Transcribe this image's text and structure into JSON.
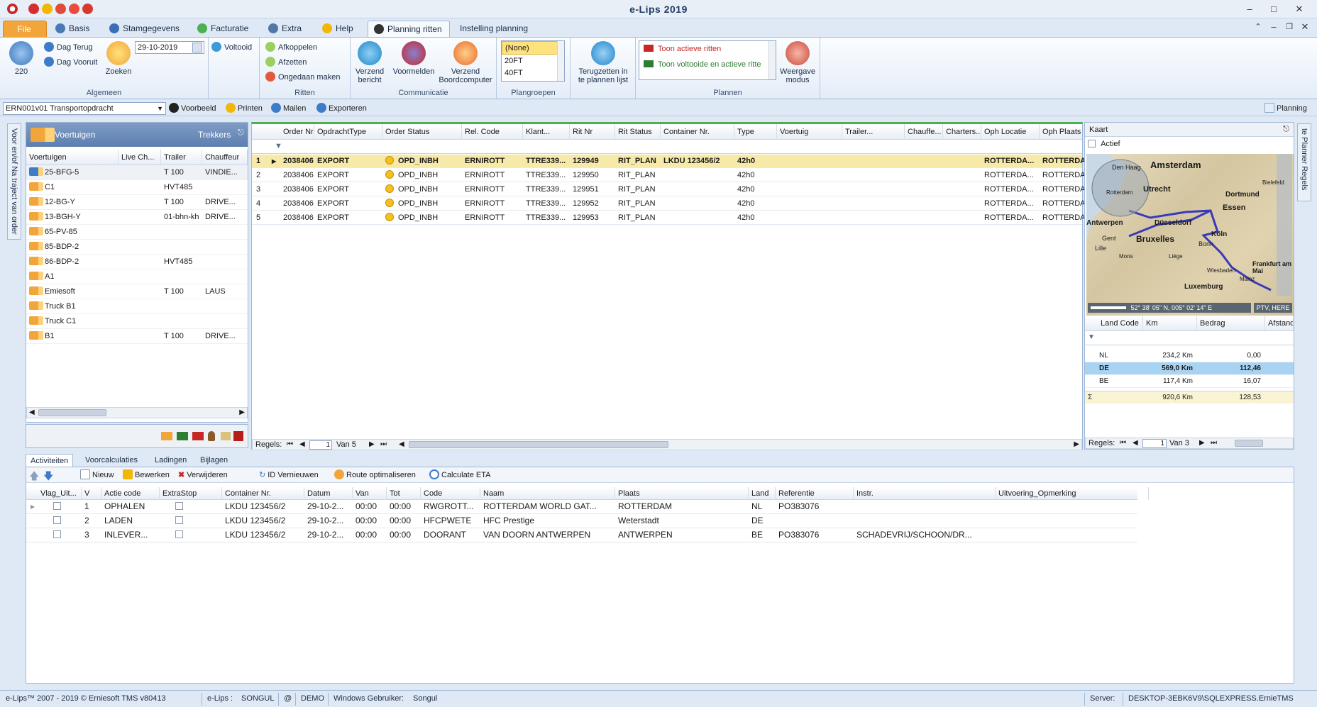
{
  "window": {
    "title": "e-Lips 2019"
  },
  "tabs": [
    {
      "label": "File"
    },
    {
      "label": "Basis"
    },
    {
      "label": "Stamgegevens"
    },
    {
      "label": "Facturatie"
    },
    {
      "label": "Extra"
    },
    {
      "label": "Help"
    },
    {
      "label": "Planning ritten"
    },
    {
      "label": "Instelling planning"
    }
  ],
  "ribbon": {
    "algemeen": {
      "label": "Algemeen",
      "refresh_count": "220",
      "dag_terug": "Dag Terug",
      "dag_vooruit": "Dag Vooruit",
      "zoeken": "Zoeken",
      "date": "29-10-2019",
      "voltooid": "Voltooid"
    },
    "ritten": {
      "label": "Ritten",
      "afkoppelen": "Afkoppelen",
      "afzetten": "Afzetten",
      "ongedaan": "Ongedaan maken"
    },
    "communicatie": {
      "label": "Communicatie",
      "verzend_bericht_1": "Verzend",
      "verzend_bericht_2": "bericht",
      "voormelden": "Voormelden",
      "boordcomputer_1": "Verzend",
      "boordcomputer_2": "Boordcomputer"
    },
    "plangroepen": {
      "label": "Plangroepen",
      "items": [
        "(None)",
        "20FT",
        "40FT"
      ]
    },
    "terug": {
      "line1": "Terugzetten in",
      "line2": "te plannen lijst"
    },
    "plannen": {
      "label": "Plannen",
      "toon_actieve": "Toon actieve ritten",
      "toon_voltooide": "Toon voltooide en actieve ritte",
      "weergave_1": "Weergave",
      "weergave_2": "modus"
    }
  },
  "toolbar2": {
    "report": "ERN001v01 Transportopdracht",
    "voorbeeld": "Voorbeeld",
    "printen": "Printen",
    "mailen": "Mailen",
    "exporteren": "Exporteren",
    "planning": "Planning"
  },
  "left_side_label": "Voor en/of Na traject van order",
  "right_side_label": "te Planner Regels",
  "vehicles": {
    "title": "Voertuigen",
    "trekkers": "Trekkers",
    "columns": [
      "Voertuigen",
      "Live Ch...",
      "Trailer",
      "Chauffeur"
    ],
    "rows": [
      {
        "name": "25-BFG-5",
        "live": "",
        "trailer": "T 100",
        "driver": "VINDIE..."
      },
      {
        "name": "C1",
        "live": "",
        "trailer": "HVT485",
        "driver": ""
      },
      {
        "name": "12-BG-Y",
        "live": "",
        "trailer": "T 100",
        "driver": "DRIVE..."
      },
      {
        "name": "13-BGH-Y",
        "live": "",
        "trailer": "01-bhn-kh",
        "driver": "DRIVE..."
      },
      {
        "name": "65-PV-85",
        "live": "",
        "trailer": "",
        "driver": ""
      },
      {
        "name": "85-BDP-2",
        "live": "",
        "trailer": "",
        "driver": ""
      },
      {
        "name": "86-BDP-2",
        "live": "",
        "trailer": "HVT485",
        "driver": ""
      },
      {
        "name": "A1",
        "live": "",
        "trailer": "",
        "driver": ""
      },
      {
        "name": "Emiesoft",
        "live": "",
        "trailer": "T 100",
        "driver": "LAUS"
      },
      {
        "name": "Truck B1",
        "live": "",
        "trailer": "",
        "driver": ""
      },
      {
        "name": "Truck C1",
        "live": "",
        "trailer": "",
        "driver": ""
      },
      {
        "name": "B1",
        "live": "",
        "trailer": "T 100",
        "driver": "DRIVE..."
      }
    ]
  },
  "orders": {
    "columns": [
      "Order Nr",
      "OpdrachtType",
      "Order Status",
      "Rel. Code",
      "Klant...",
      "Rit Nr",
      "Rit Status",
      "Container Nr.",
      "Type",
      "Voertuig",
      "Trailer...",
      "Chauffe...",
      "Charters...",
      "Oph Locatie",
      "Oph Plaats"
    ],
    "rows": [
      {
        "idx": "1",
        "order": "2038406",
        "type": "EXPORT",
        "status": "OPD_INBH",
        "rel": "ERNIROTT",
        "klant": "TTRE339...",
        "rit": "129949",
        "ritstatus": "RIT_PLAN",
        "container": "LKDU 123456/2",
        "ctype": "42h0",
        "loc": "ROTTERDA...",
        "plaats": "ROTTERDAM"
      },
      {
        "idx": "2",
        "order": "2038406",
        "type": "EXPORT",
        "status": "OPD_INBH",
        "rel": "ERNIROTT",
        "klant": "TTRE339...",
        "rit": "129950",
        "ritstatus": "RIT_PLAN",
        "container": "",
        "ctype": "42h0",
        "loc": "ROTTERDA...",
        "plaats": "ROTTERDAM"
      },
      {
        "idx": "3",
        "order": "2038406",
        "type": "EXPORT",
        "status": "OPD_INBH",
        "rel": "ERNIROTT",
        "klant": "TTRE339...",
        "rit": "129951",
        "ritstatus": "RIT_PLAN",
        "container": "",
        "ctype": "42h0",
        "loc": "ROTTERDA...",
        "plaats": "ROTTERDAM"
      },
      {
        "idx": "4",
        "order": "2038406",
        "type": "EXPORT",
        "status": "OPD_INBH",
        "rel": "ERNIROTT",
        "klant": "TTRE339...",
        "rit": "129952",
        "ritstatus": "RIT_PLAN",
        "container": "",
        "ctype": "42h0",
        "loc": "ROTTERDA...",
        "plaats": "ROTTERDAM"
      },
      {
        "idx": "5",
        "order": "2038406",
        "type": "EXPORT",
        "status": "OPD_INBH",
        "rel": "ERNIROTT",
        "klant": "TTRE339...",
        "rit": "129953",
        "ritstatus": "RIT_PLAN",
        "container": "",
        "ctype": "42h0",
        "loc": "ROTTERDA...",
        "plaats": "ROTTERDAM"
      }
    ],
    "footer": {
      "regels": "Regels:",
      "page": "1",
      "van": "Van 5"
    }
  },
  "map": {
    "title": "Kaart",
    "actief": "Actief",
    "cities": [
      "Den Haag",
      "Amsterdam",
      "Utrecht",
      "Rotterdam",
      "Bielefeld",
      "Dortmund",
      "Essen",
      "Antwerpen",
      "Düsseldorf",
      "Köln",
      "Gent",
      "Bruxelles",
      "Bonn",
      "Lille",
      "Mons",
      "Liège",
      "Wiesbaden",
      "Frankfurt am Mai",
      "Luxemburg",
      "Mainz"
    ],
    "coords": "52° 38' 05\" N, 005° 02' 14\" E",
    "credit": "PTV, HERE",
    "table": {
      "columns": [
        "Land Code",
        "Km",
        "Bedrag",
        "AfstandT"
      ],
      "rows": [
        {
          "code": "NL",
          "km": "234,2 Km",
          "bedrag": "0,00"
        },
        {
          "code": "DE",
          "km": "569,0 Km",
          "bedrag": "112,46"
        },
        {
          "code": "BE",
          "km": "117,4 Km",
          "bedrag": "16,07"
        }
      ],
      "total": {
        "km": "920,6 Km",
        "bedrag": "128,53"
      }
    },
    "footer": {
      "regels": "Regels:",
      "page": "1",
      "van": "Van 3"
    }
  },
  "bottom": {
    "tabs": [
      "Activiteiten",
      "Voorcalculaties",
      "Ladingen",
      "Bijlagen"
    ],
    "toolbar": {
      "nieuw": "Nieuw",
      "bewerken": "Bewerken",
      "verwijderen": "Verwijderen",
      "id": "ID Vernieuwen",
      "route": "Route optimaliseren",
      "eta": "Calculate ETA"
    },
    "columns": [
      "Vlag_Uit...",
      "V",
      "Actie code",
      "ExtraStop",
      "Container Nr.",
      "Datum",
      "Van",
      "Tot",
      "Code",
      "Naam",
      "Plaats",
      "Land",
      "Referentie",
      "Instr.",
      "Uitvoering_Opmerking"
    ],
    "rows": [
      {
        "v": "1",
        "actie": "OPHALEN",
        "container": "LKDU 123456/2",
        "datum": "29-10-2...",
        "van": "00:00",
        "tot": "00:00",
        "code": "RWGROTT...",
        "naam": "ROTTERDAM  WORLD  GAT...",
        "plaats": "ROTTERDAM",
        "land": "NL",
        "ref": "PO383076",
        "instr": ""
      },
      {
        "v": "2",
        "actie": "LADEN",
        "container": "LKDU 123456/2",
        "datum": "29-10-2...",
        "van": "00:00",
        "tot": "00:00",
        "code": "HFCPWETE",
        "naam": "HFC Prestige",
        "plaats": "Weterstadt",
        "land": "DE",
        "ref": "",
        "instr": ""
      },
      {
        "v": "3",
        "actie": "INLEVER...",
        "container": "LKDU 123456/2",
        "datum": "29-10-2...",
        "van": "00:00",
        "tot": "00:00",
        "code": "DOORANT",
        "naam": "VAN DOORN ANTWERPEN",
        "plaats": "ANTWERPEN",
        "land": "BE",
        "ref": "PO383076",
        "instr": "SCHADEVRIJ/SCHOON/DR..."
      }
    ]
  },
  "statusbar": {
    "copyright": "e-Lips™ 2007 - 2019 © Erniesoft TMS v80413",
    "app": "e-Lips :",
    "user": "SONGUL",
    "at": "@",
    "db": "DEMO",
    "win_label": "Windows Gebruiker:",
    "win_user": "Songul",
    "server_label": "Server:",
    "server": "DESKTOP-3EBK6V9\\SQLEXPRESS.ErnieTMS"
  },
  "colors": {
    "accent": "#f2a53a",
    "selected": "#f7e9a8",
    "header_blue": "#5c7fb0",
    "de_row": "#a9d3f2"
  }
}
